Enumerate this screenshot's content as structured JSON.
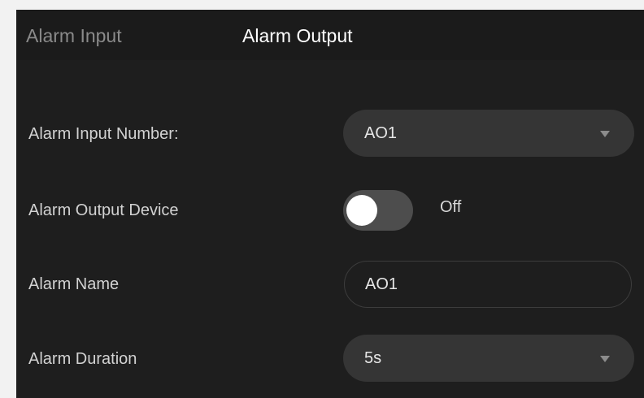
{
  "tabs": [
    {
      "label": "Alarm Input",
      "active": false
    },
    {
      "label": "Alarm Output",
      "active": true
    }
  ],
  "form": {
    "alarm_input_number": {
      "label": "Alarm Input Number:",
      "value": "AO1"
    },
    "alarm_output_device": {
      "label": "Alarm Output Device",
      "enabled": false,
      "state_text": "Off"
    },
    "alarm_name": {
      "label": "Alarm Name",
      "value": "AO1"
    },
    "alarm_duration": {
      "label": "Alarm Duration",
      "value": "5s"
    }
  },
  "icons": {
    "dropdown": "chevron-down-icon"
  },
  "colors": {
    "panel_background": "#1e1e1e",
    "control_background": "#353535",
    "toggle_off_track": "#4d4d4d",
    "active_tab_text": "#ffffff",
    "inactive_tab_text": "#8a8a8a"
  }
}
